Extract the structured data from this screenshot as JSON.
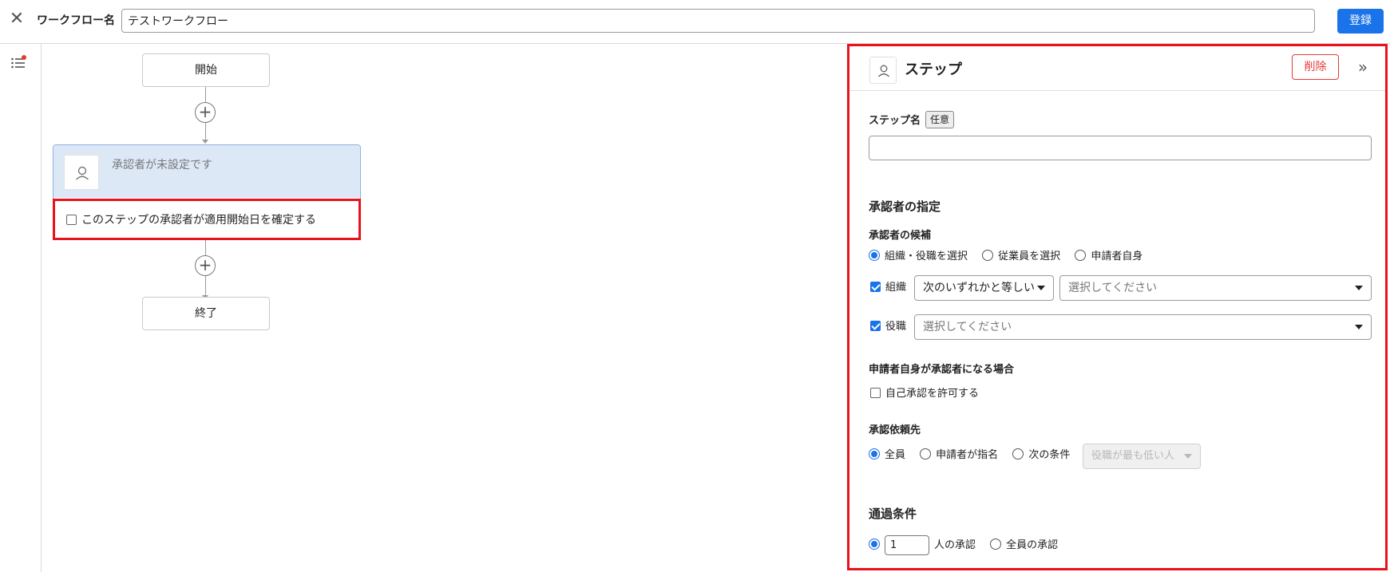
{
  "header": {
    "close_label": "✕",
    "workflow_name_label": "ワークフロー名",
    "workflow_name_value": "テストワークフロー",
    "register_label": "登録"
  },
  "canvas": {
    "start_label": "開始",
    "end_label": "終了",
    "step_card": {
      "unset_text": "承認者が未設定です",
      "confirm_checkbox_label": "このステップの承認者が適用開始日を確定する",
      "confirm_checked": false
    }
  },
  "panel": {
    "title": "ステップ",
    "delete_label": "削除",
    "collapse_label": "»",
    "step_name_label": "ステップ名",
    "optional_tag": "任意",
    "step_name_value": "",
    "approver_section_title": "承認者の指定",
    "candidates_label": "承認者の候補",
    "candidate_options": [
      "組織・役職を選択",
      "従業員を選択",
      "申請者自身"
    ],
    "candidate_selected": 0,
    "org_label": "組織",
    "org_checked": true,
    "org_condition_value": "次のいずれかと等しい",
    "org_select_placeholder": "選択してください",
    "position_label": "役職",
    "position_checked": true,
    "position_select_placeholder": "選択してください",
    "self_approver_label": "申請者自身が承認者になる場合",
    "self_approval_checkbox_label": "自己承認を許可する",
    "self_approval_checked": false,
    "request_to_label": "承認依頼先",
    "request_options": [
      "全員",
      "申請者が指名",
      "次の条件"
    ],
    "request_selected": 0,
    "request_condition_value": "役職が最も低い人",
    "pass_condition_title": "通過条件",
    "pass_count_value": "1",
    "pass_count_suffix": "人の承認",
    "pass_all_label": "全員の承認",
    "pass_selected": 0
  }
}
